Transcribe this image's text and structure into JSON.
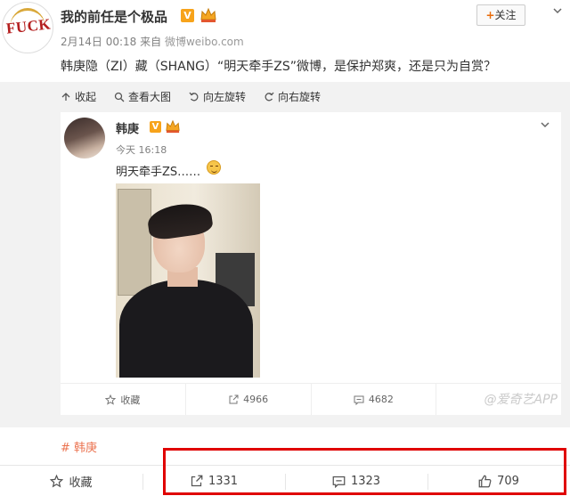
{
  "post": {
    "avatar_text": "FUCK",
    "username": "我的前任是个极品",
    "vip_badge": "V",
    "date": "2月14日 00:18",
    "source_prefix": "来自",
    "source": "微博weibo.com",
    "follow_plus": "+",
    "follow_label": "关注",
    "headline": "韩庚隐（ZI）藏（SHANG）“明天牵手ZS”微博，是保护郑爽，还是只为自赏？"
  },
  "image_toolbar": {
    "collapse": "收起",
    "view_large": "查看大图",
    "rotate_left": "向左旋转",
    "rotate_right": "向右旋转"
  },
  "repost": {
    "username": "韩庚",
    "vip_badge": "V",
    "time": "今天 16:18",
    "text": "明天牵手ZS……",
    "actions": {
      "favorite": "收藏",
      "repost_count": "4966",
      "comment_count": "4682",
      "like_count": ""
    }
  },
  "watermark": "@爱奇艺APP",
  "topic": "# 韩庚",
  "actions": {
    "favorite": "收藏",
    "repost_count": "1331",
    "comment_count": "1323",
    "like_count": "709"
  },
  "colors": {
    "accent_orange": "#eb7350",
    "vip_badge": "#f7a31b",
    "highlight_box": "#e00000"
  }
}
